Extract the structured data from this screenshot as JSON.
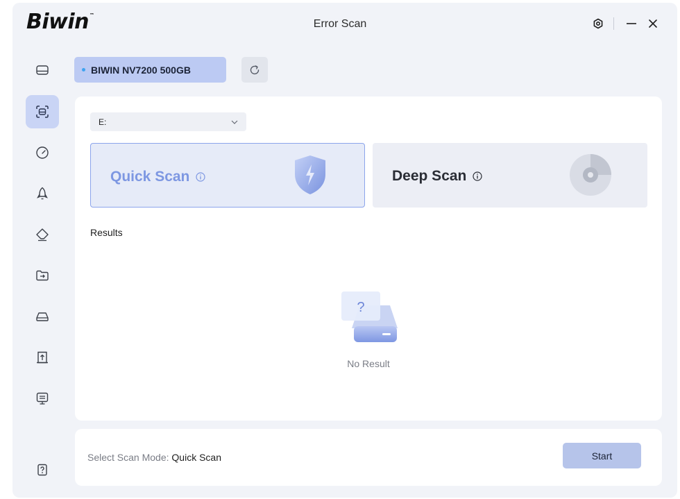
{
  "app": {
    "logo": "Biwin",
    "logo_tm": "™",
    "title": "Error Scan"
  },
  "sidebar": {
    "items": [
      {
        "name": "disk",
        "active": false
      },
      {
        "name": "error-scan",
        "active": true
      },
      {
        "name": "speed-test",
        "active": false
      },
      {
        "name": "boost",
        "active": false
      },
      {
        "name": "erase",
        "active": false
      },
      {
        "name": "migrate",
        "active": false
      },
      {
        "name": "drive-info",
        "active": false
      },
      {
        "name": "firmware-update",
        "active": false
      },
      {
        "name": "monitor",
        "active": false
      }
    ],
    "help_icon": "help-icon"
  },
  "device": {
    "name": "BIWIN NV7200 500GB"
  },
  "drive_select": {
    "value": "E:"
  },
  "scan_modes": {
    "quick": {
      "label": "Quick Scan",
      "selected": true
    },
    "deep": {
      "label": "Deep Scan",
      "selected": false
    }
  },
  "results": {
    "label": "Results",
    "empty_text": "No Result"
  },
  "footer": {
    "mode_prefix": "Select Scan Mode: ",
    "mode_value": "Quick Scan",
    "start_label": "Start"
  },
  "colors": {
    "accent": "#7d97e2",
    "accent_soft": "#bccaf3",
    "window_bg": "#f1f3f8"
  }
}
